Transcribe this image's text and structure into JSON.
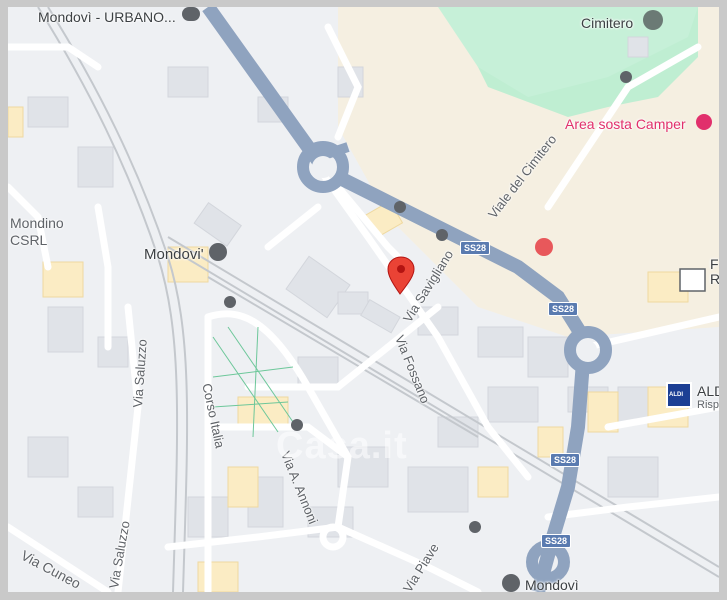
{
  "places": {
    "mondovi_urbano": "Mondovì - URBANO...",
    "cimitero": "Cimitero",
    "area_sosta": "Area sosta Camper",
    "mondino": "Mondino",
    "mondino2": "CSRL",
    "mondovi_station": "Mondovi'",
    "aldi": "ALDI",
    "aldi_sub": "Risp",
    "aldi_logo": "ALDI",
    "mondovi_bottom": "Mondovì",
    "edge_r1": "F",
    "edge_r2": "R"
  },
  "streets": {
    "viale_cimitero": "Viale del Cimitero",
    "via_savigliano": "Via Savigliano",
    "via_fossano": "Via Fossano",
    "via_saluzzo": "Via Saluzzo",
    "via_saluzzo_2": "Via Saluzzo",
    "corso_italia": "Corso Italia",
    "via_annoni": "Via A. Annoni",
    "via_cuneo": "Via Cuneo",
    "via_piave": "Via Piave"
  },
  "shields": [
    "SS28",
    "SS28",
    "SS28",
    "SS28"
  ],
  "watermark": "Casa.it",
  "colors": {
    "arterial": "#8fa3bf",
    "road": "#ffffff",
    "rail": "#c4c8cd",
    "park": "#bfeed2",
    "sand": "#f5efe1",
    "building": "#e0e3e8",
    "highlight_building": "#fbecc4",
    "pin": "#ea4335"
  }
}
